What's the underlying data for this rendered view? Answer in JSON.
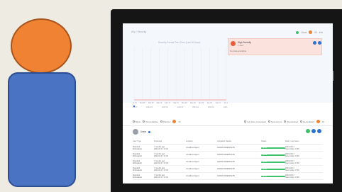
{
  "breadcrumb": {
    "root": "Ally",
    "current": "Security"
  },
  "header": {
    "status_label": "Good",
    "count_label": "93",
    "user_label": "Info"
  },
  "chart_title": "Security Events Over Time (Last 30 Days)",
  "notification": {
    "title": "High Severity",
    "subtitle": "1 alert",
    "body": "No data available"
  },
  "filters": {
    "left": [
      "Block",
      "Vulnerabilities",
      "Patches"
    ],
    "left_count": "26",
    "right": [
      "Full Scan Completed",
      "Scan Errors",
      "Quarantined",
      "Remediated"
    ],
    "right_count": "26"
  },
  "users": {
    "label": "Users"
  },
  "table": {
    "columns": [
      "User Type",
      "Protected",
      "Location",
      "Activation Details",
      "Status",
      "Date / Last Seen"
    ],
    "rows": [
      {
        "type": "Standard",
        "type2": "Workstation",
        "protected": "7 months ago",
        "protected2": "2023-03-17 17:06",
        "location": "Undefined Agent",
        "details": "0A1B2C3D4E5F6A7B",
        "status": "Active",
        "date": "2023-03-17",
        "date2": "Seen today 17:06"
      },
      {
        "type": "Standard",
        "type2": "Workstation",
        "protected": "7 months ago",
        "protected2": "2023-03-17 17:06",
        "location": "Undefined Agent",
        "details": "0A1B2C3D4E5F6A7B",
        "status": "Active",
        "date": "2023-03-17",
        "date2": "Seen today 17:06"
      },
      {
        "type": "Standard",
        "type2": "Workstation",
        "protected": "7 months ago",
        "protected2": "2023-03-17 17:06",
        "location": "Undefined Agent",
        "details": "0A1B2C3D4E5F6A7B",
        "status": "Active",
        "date": "2023-03-17",
        "date2": "Seen today 17:06"
      },
      {
        "type": "Standard",
        "type2": "Workstation",
        "protected": "7 months ago",
        "protected2": "2023-03-17 17:06",
        "location": "Undefined Agent",
        "details": "0A1B2C3D4E5F6A7B",
        "status": "Active",
        "date": "2023-03-17",
        "date2": "Seen today 17:06"
      },
      {
        "type": "Standard",
        "type2": "Workstation",
        "protected": "7 months ago",
        "protected2": "2023-03-17 17:06",
        "location": "Undefined Agent",
        "details": "0A1B2C3D4E5F6A7B",
        "status": "Active",
        "date": "2023-03-17",
        "date2": "Seen today 17:06"
      }
    ]
  },
  "chart_data": {
    "type": "line",
    "x": [
      "Mar 01",
      "Mar 05",
      "Mar 09",
      "Mar 13",
      "Mar 17",
      "Mar 21",
      "Mar 25",
      "Mar 29",
      "Apr 02",
      "Apr 06",
      "Apr 10",
      "Apr 14"
    ],
    "x_ticks_bottom": [
      "2023-03",
      "2023-03",
      "2023-04",
      "2023-04",
      "2023-04",
      "2023-04",
      "2023-04"
    ],
    "series": [
      {
        "values": [
          0,
          0,
          0,
          0,
          0,
          0,
          0,
          0,
          0,
          0,
          0,
          0
        ],
        "color": "#f08a8a"
      }
    ],
    "ylim": [
      0,
      10
    ],
    "grid": true
  },
  "colors": {
    "accent": "#2e72d2",
    "success": "#3cc26a",
    "warning": "#f08233",
    "danger": "#e85d3a"
  }
}
